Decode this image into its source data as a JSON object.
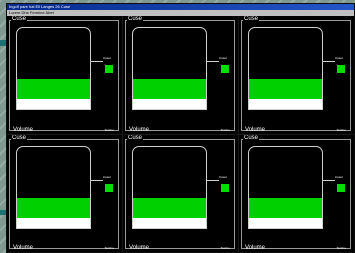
{
  "window": {
    "title": "Ingolf pare hal Eil Langes 26 Cuse",
    "menu": "Lorem Dhe Fermine Abet"
  },
  "panels": [
    {
      "title": "Cuse",
      "volume_label": "Volume",
      "small_label": "Textine",
      "level_label": "Cusel",
      "green_level": 0.25,
      "white_level": 0.12
    },
    {
      "title": "Cuse",
      "volume_label": "Volume",
      "small_label": "Textine",
      "level_label": "Cusel",
      "green_level": 0.25,
      "white_level": 0.12
    },
    {
      "title": "Cuse",
      "volume_label": "Volume",
      "small_label": "Textine",
      "level_label": "Cusel",
      "green_level": 0.25,
      "white_level": 0.12
    },
    {
      "title": "Cuse",
      "volume_label": "Volume",
      "small_label": "Textine",
      "level_label": "Cusel",
      "green_level": 0.25,
      "white_level": 0.12
    },
    {
      "title": "Cuse",
      "volume_label": "Volume",
      "small_label": "Textine",
      "level_label": "Cusel",
      "green_level": 0.25,
      "white_level": 0.12
    },
    {
      "title": "Cuse",
      "volume_label": "Volume",
      "small_label": "Textine",
      "level_label": "Cusel",
      "green_level": 0.25,
      "white_level": 0.12
    }
  ],
  "colors": {
    "tank_green": "#00d000",
    "lamp_green": "#00e000",
    "background": "#000000"
  }
}
